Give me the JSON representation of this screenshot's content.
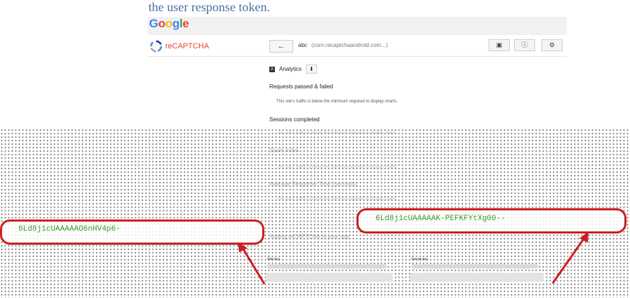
{
  "heading": "the user response token.",
  "google_logo": {
    "letters": [
      "G",
      "o",
      "o",
      "g",
      "l",
      "e"
    ],
    "colors": [
      "#4285f4",
      "#ea4335",
      "#fbbc05",
      "#4285f4",
      "#34a853",
      "#ea4335"
    ]
  },
  "app": {
    "name": "reCAPTCHA",
    "back_label": "←",
    "site_label": "abc",
    "site_domain": "(com.recaptchaandroid.com...)"
  },
  "toolbar": {
    "icons": [
      "bookmark-icon",
      "info-icon",
      "gear-icon"
    ],
    "glyphs": [
      "▣",
      "ⓘ",
      "⚙"
    ]
  },
  "analytics": {
    "label": "Analytics",
    "icon_glyph": "A",
    "download_glyph": "⬇"
  },
  "sections": [
    {
      "title": "Requests passed & failed",
      "note": "This site's traffic is below the minimum required to display charts."
    },
    {
      "title": "Sessions completed",
      "note": "This site's traffic is below the minimum required to display charts."
    },
    {
      "title": "Spam index",
      "note": "This site's traffic is below the minimum required to display charts."
    },
    {
      "title": "Average Response Time (seconds)",
      "note": "This site's traffic is below the minimum required to display charts."
    }
  ],
  "adding": "Adding reCAPTCHA to your app",
  "site_key_label": "Site key",
  "secret_key_label": "Secret key",
  "callouts": {
    "site_key": "6Ld8j1cUAAAAAO6nHV4p6-",
    "secret_key": "6Ld8j1cUAAAAAK-PEFKFYtXg00--"
  },
  "colors": {
    "annotation": "#cc1f1f",
    "key_text": "#3a9a2a"
  }
}
